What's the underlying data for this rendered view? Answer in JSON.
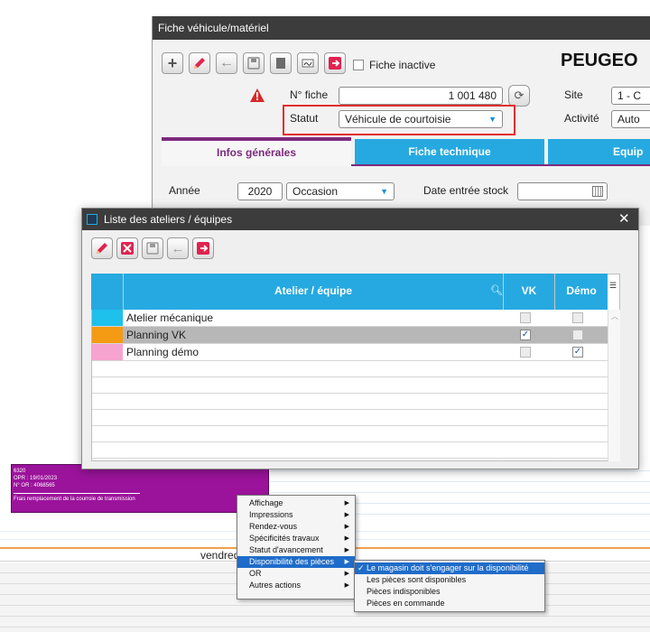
{
  "fiche": {
    "title": "Fiche véhicule/matériel",
    "inactive_label": "Fiche inactive",
    "brand": "PEUGEO",
    "nfiche_label": "N° fiche",
    "nfiche_value": "1 001 480",
    "statut_label": "Statut",
    "statut_value": "Véhicule de courtoisie",
    "site_label": "Site",
    "site_value": "1 - C",
    "activite_label": "Activité",
    "activite_value": "Auto",
    "tabs": [
      "Infos générales",
      "Fiche technique",
      "Equip"
    ],
    "annee_label": "Année",
    "annee_value": "2020",
    "occasion_value": "Occasion",
    "date_stock_label": "Date entrée stock"
  },
  "dialog": {
    "title": "Liste des ateliers / équipes",
    "headers": {
      "atelier": "Atelier / équipe",
      "vk": "VK",
      "demo": "Démo"
    },
    "rows": [
      {
        "name": "Atelier mécanique",
        "color": "#1ec0ec",
        "vk": false,
        "demo": false
      },
      {
        "name": "Planning VK",
        "color": "#f59a13",
        "vk": true,
        "demo": false
      },
      {
        "name": "Planning démo",
        "color": "#f6a3cf",
        "vk": false,
        "demo": true
      }
    ]
  },
  "calendar": {
    "event_lines": [
      "6320",
      "OPR : 19/01/2023",
      "N° OR : 4068565",
      "Frais remplacement de la courroie de transmission"
    ],
    "day_label": "vendred"
  },
  "context_menu": {
    "items": [
      "Affichage",
      "Impressions",
      "Rendez-vous",
      "Spécificités travaux",
      "Statut d'avancement",
      "Disponibilité des pièces",
      "OR",
      "Autres actions"
    ],
    "submenu": [
      "Le magasin doit s'engager sur la disponibilité",
      "Les pièces sont disponibles",
      "Pièces indisponibles",
      "Pièces en commande"
    ]
  },
  "colors": {
    "accent": "#26a9e0",
    "tab_active": "#7d2a7e",
    "event": "#9b139b",
    "highlight": "#1f6cc9",
    "status_box": "#e32d2d"
  }
}
